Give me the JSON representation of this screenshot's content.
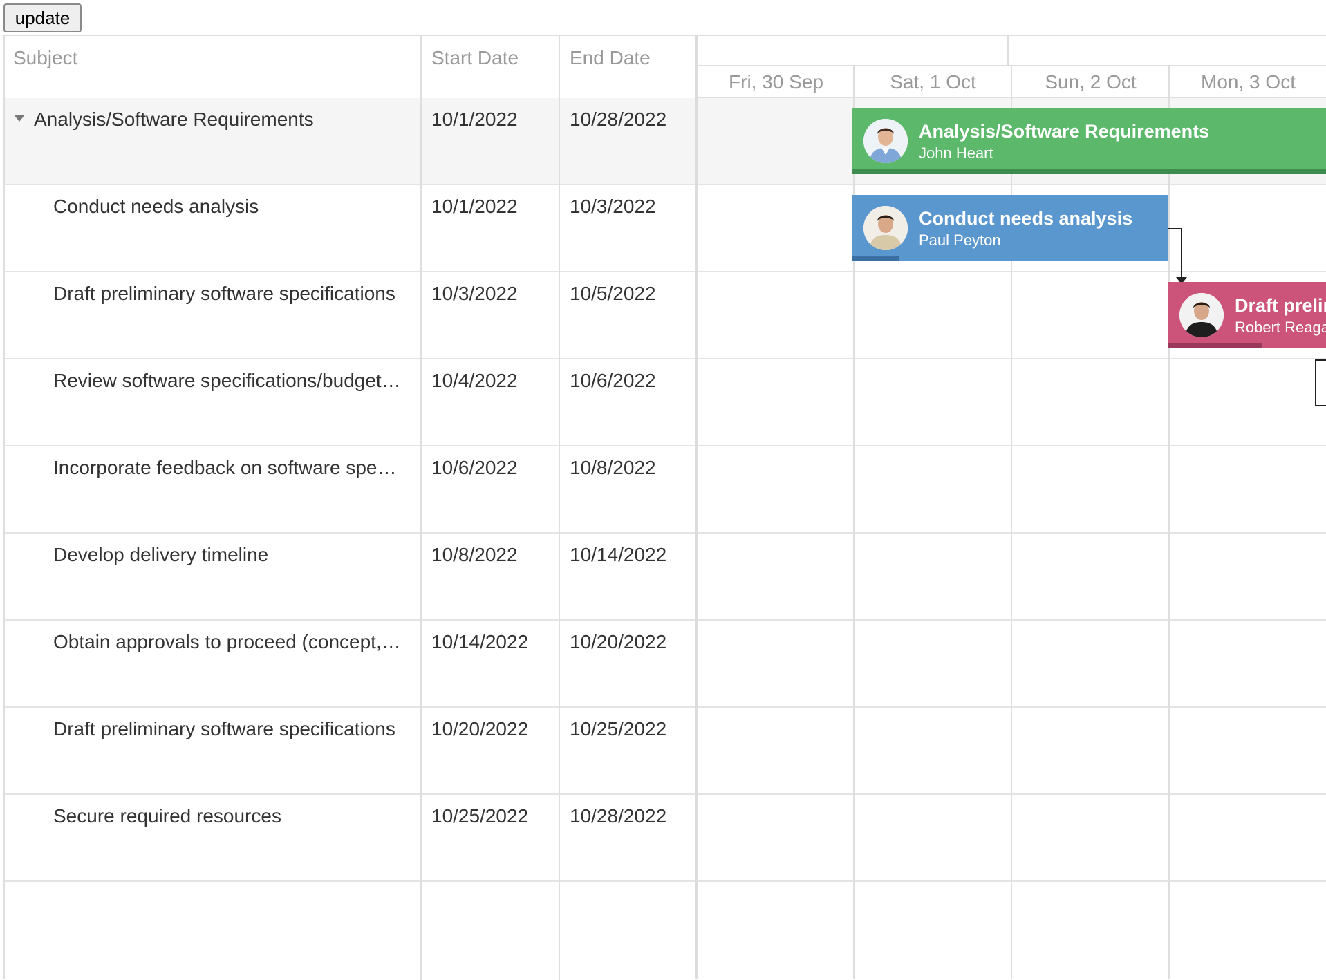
{
  "toolbar": {
    "update_label": "update"
  },
  "grid": {
    "columns": {
      "subject": "Subject",
      "start": "Start Date",
      "end": "End Date"
    },
    "rows": [
      {
        "subject": "Analysis/Software Requirements",
        "start": "10/1/2022",
        "end": "10/28/2022",
        "summary": true
      },
      {
        "subject": "Conduct needs analysis",
        "start": "10/1/2022",
        "end": "10/3/2022"
      },
      {
        "subject": "Draft preliminary software specifications",
        "start": "10/3/2022",
        "end": "10/5/2022"
      },
      {
        "subject": "Review software specifications/budget…",
        "start": "10/4/2022",
        "end": "10/6/2022"
      },
      {
        "subject": "Incorporate feedback on software spe…",
        "start": "10/6/2022",
        "end": "10/8/2022"
      },
      {
        "subject": "Develop delivery timeline",
        "start": "10/8/2022",
        "end": "10/14/2022"
      },
      {
        "subject": "Obtain approvals to proceed (concept,…",
        "start": "10/14/2022",
        "end": "10/20/2022"
      },
      {
        "subject": "Draft preliminary software specifications",
        "start": "10/20/2022",
        "end": "10/25/2022"
      },
      {
        "subject": "Secure required resources",
        "start": "10/25/2022",
        "end": "10/28/2022"
      }
    ]
  },
  "timeline": {
    "days": [
      "Fri, 30 Sep",
      "Sat, 1 Oct",
      "Sun, 2 Oct",
      "Mon, 3 Oct"
    ],
    "bars": {
      "summary": {
        "title": "Analysis/Software Requirements",
        "owner": "John Heart",
        "color": "#5cb96b",
        "progress_color": "#3f8a4d"
      },
      "needs": {
        "title": "Conduct needs analysis",
        "owner": "Paul Peyton",
        "color": "#5b97cf",
        "progress_color": "#3a6fa3"
      },
      "draft": {
        "title": "Draft preliminary software specifications",
        "owner": "Robert Reagan",
        "color": "#cc537a",
        "progress_color": "#99385a"
      }
    }
  },
  "colors": {
    "border": "#dedede",
    "summary_row_bg": "#f5f5f5",
    "header_text": "#999999"
  }
}
